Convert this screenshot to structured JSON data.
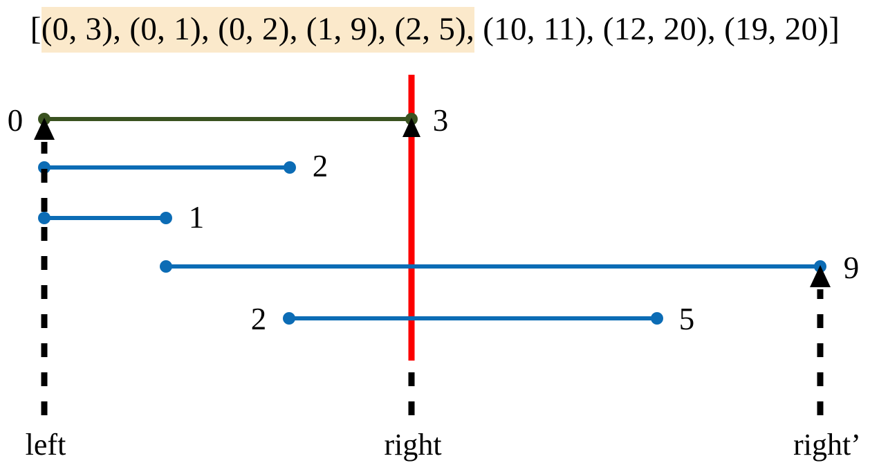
{
  "title": {
    "prefix": "[",
    "highlighted": "(0, 3), (0, 1), (0, 2), (1, 9), (2, 5),",
    "rest": " (10, 11), (12, 20), (19, 20)]",
    "highlight_color": "#fbe9cb",
    "full_text": "[(0, 3), (0, 1), (0, 2), (1, 9), (2, 5), (10, 11), (12, 20), (19, 20)]"
  },
  "colors": {
    "green": "#3a5220",
    "blue": "#0c6cb5",
    "red": "#fc0000",
    "black": "#000000"
  },
  "intervals": [
    {
      "start_label": "0",
      "end_label": "3",
      "color": "green",
      "start": 0,
      "end": 3
    },
    {
      "start_label": "",
      "end_label": "2",
      "color": "blue",
      "start": 0,
      "end": 2
    },
    {
      "start_label": "",
      "end_label": "1",
      "color": "blue",
      "start": 0,
      "end": 1
    },
    {
      "start_label": "",
      "end_label": "9",
      "color": "blue",
      "start": 1,
      "end": 9
    },
    {
      "start_label": "2",
      "end_label": "5",
      "color": "blue",
      "start": 2,
      "end": 5
    }
  ],
  "markers": {
    "left": {
      "label": "left",
      "value": 0
    },
    "right": {
      "label": "right",
      "value": 3
    },
    "right_prime": {
      "label": "right’",
      "value": 9
    }
  },
  "chart_data": {
    "type": "interval-diagram",
    "title": "[(0, 3), (0, 1), (0, 2), (1, 9), (2, 5), (10, 11), (12, 20), (19, 20)]",
    "segments": [
      {
        "row": 1,
        "start": 0,
        "end": 3,
        "color": "#3a5220",
        "left_text": "0",
        "right_text": "3"
      },
      {
        "row": 2,
        "start": 0,
        "end": 2,
        "color": "#0c6cb5",
        "left_text": "",
        "right_text": "2"
      },
      {
        "row": 3,
        "start": 0,
        "end": 1,
        "color": "#0c6cb5",
        "left_text": "",
        "right_text": "1"
      },
      {
        "row": 4,
        "start": 1,
        "end": 9,
        "color": "#0c6cb5",
        "left_text": "",
        "right_text": "9"
      },
      {
        "row": 5,
        "start": 2,
        "end": 5,
        "color": "#0c6cb5",
        "left_text": "2",
        "right_text": "5"
      }
    ],
    "vertical_guides": [
      {
        "name": "left",
        "label": "left",
        "x_value": 0,
        "style": "dashed-black",
        "arrow": "up"
      },
      {
        "name": "right",
        "label": "right",
        "x_value": 3,
        "style": "solid-red-top-dashed-black",
        "arrow": "up"
      },
      {
        "name": "right'",
        "label": "right’",
        "x_value": 9,
        "style": "dashed-black",
        "arrow": "up"
      }
    ],
    "legend": [],
    "grid": false
  }
}
